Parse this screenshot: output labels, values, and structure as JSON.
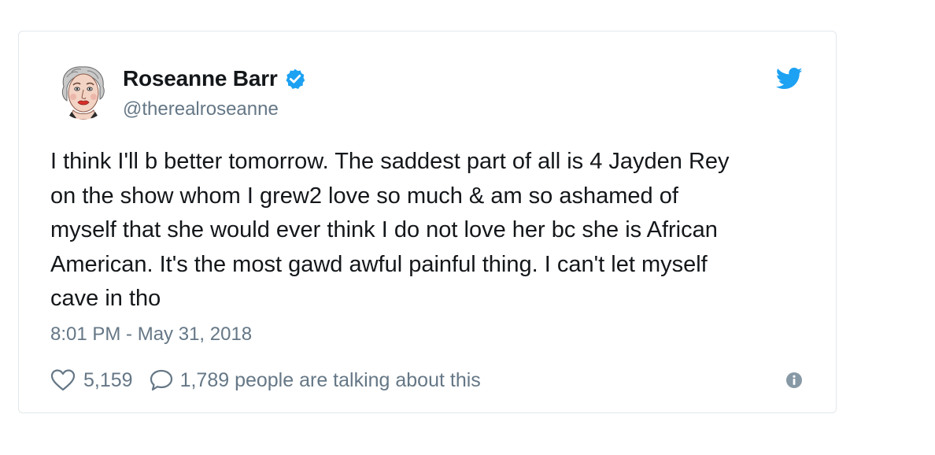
{
  "user": {
    "display_name": "Roseanne Barr",
    "handle": "@therealroseanne",
    "verified": true
  },
  "tweet": {
    "text": "I think I'll b better tomorrow. The saddest part of all is 4 Jayden Rey\non the show whom I grew2 love so much & am so ashamed of\nmyself that she would ever think I do not love her bc she is African\nAmerican. It's the most gawd awful painful thing. I can't let myself\ncave in tho",
    "timestamp": "8:01 PM - May 31, 2018"
  },
  "engagement": {
    "likes": "5,159",
    "talking_text": "1,789 people are talking about this"
  },
  "colors": {
    "twitter_blue": "#1da1f2",
    "secondary_text": "#657786",
    "primary_text": "#14171a",
    "border": "#e1e8ed"
  },
  "icons": {
    "platform": "twitter-bird-icon",
    "verified": "verified-badge-icon",
    "like": "heart-outline-icon",
    "reply": "speech-bubble-icon",
    "info": "info-circle-icon"
  }
}
